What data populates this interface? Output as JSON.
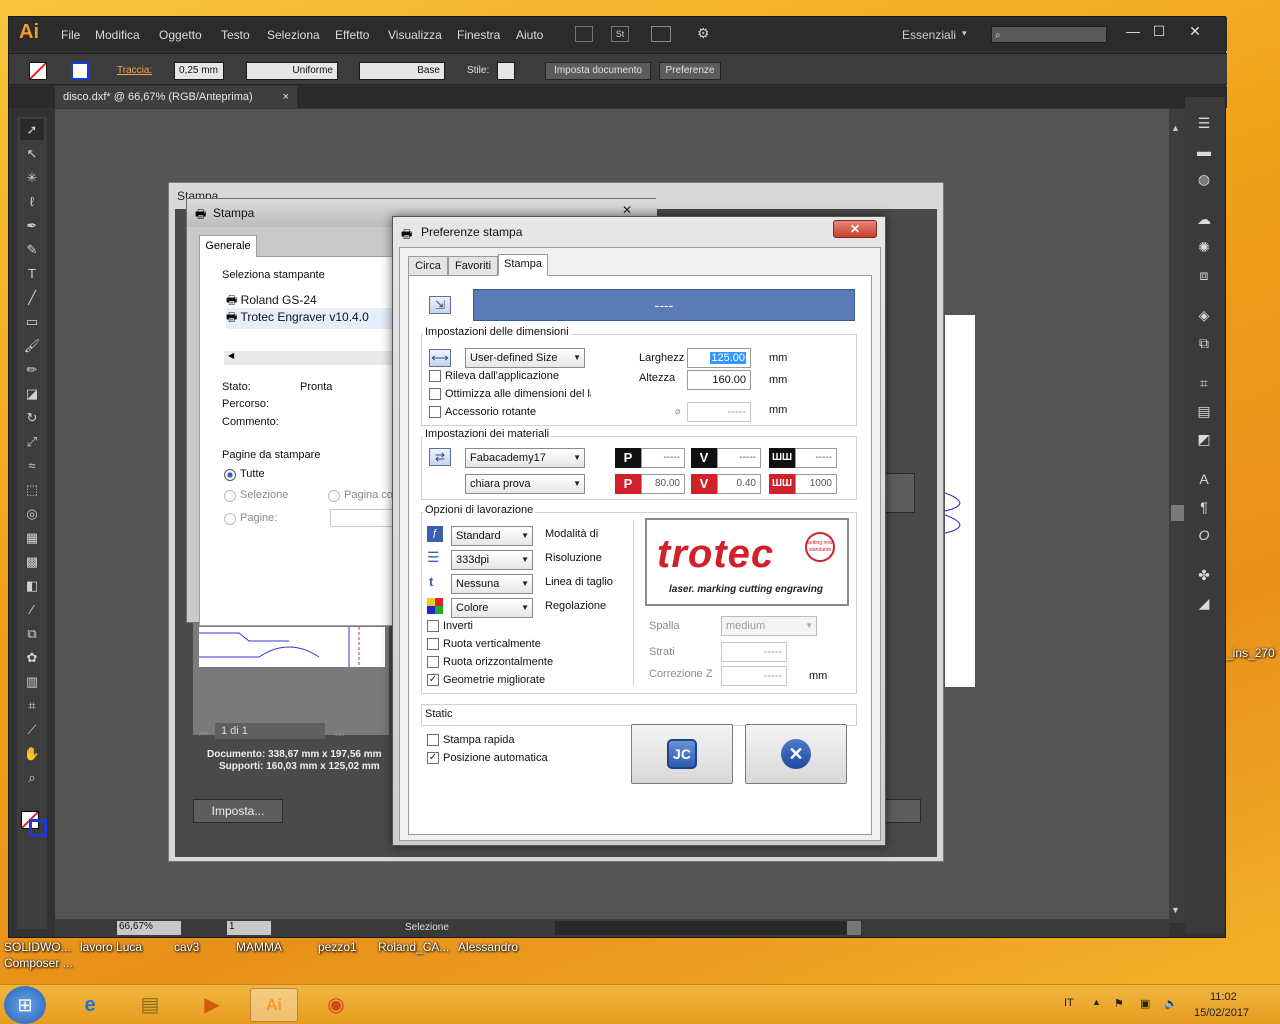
{
  "app": {
    "logo": "Ai",
    "menu": [
      "File",
      "Modifica",
      "Oggetto",
      "Testo",
      "Seleziona",
      "Effetto",
      "Visualizza",
      "Finestra",
      "Aiuto"
    ],
    "workspace": "Essenziali",
    "window_controls": {
      "min": "—",
      "max": "☐",
      "close": "✕"
    }
  },
  "controlbar": {
    "stroke_label": "Traccia:",
    "stroke_value": "0,25 mm",
    "profile": "Uniforme",
    "brush": "Base",
    "style_label": "Stile:",
    "doc_setup": "Imposta documento",
    "prefs": "Preferenze"
  },
  "document_tab": {
    "title": "disco.dxf* @ 66,67% (RGB/Anteprima)",
    "close": "×"
  },
  "statusbar": {
    "zoom": "66,67%",
    "page": "1",
    "tool": "Selezione"
  },
  "ai_print_dialog": {
    "title": "Stampa",
    "pager": "1 di 1",
    "doc_size": "Documento: 338,67 mm x 197,56 mm",
    "media_size": "Supporti: 160,03 mm x 125,02 mm",
    "setup_button": "Imposta..."
  },
  "win_print_dialog": {
    "title": "Stampa",
    "close": "✕",
    "tab": "Generale",
    "select_printer": "Seleziona stampante",
    "printers": [
      "Roland GS-24",
      "Trotec Engraver v10.4.0"
    ],
    "status_label": "Stato:",
    "status_value": "Pronta",
    "path_label": "Percorso:",
    "comment_label": "Commento:",
    "pages_group": "Pagine da stampare",
    "opt_all": "Tutte",
    "opt_selection": "Selezione",
    "opt_current": "Pagina co",
    "opt_pages": "Pagine:"
  },
  "pref": {
    "title": "Preferenze stampa",
    "close": "✕",
    "tabs": [
      "Circa",
      "Favoriti",
      "Stampa"
    ],
    "active_tab": "Stampa",
    "header_value": "----",
    "dims": {
      "group": "Impostazioni delle dimensioni",
      "size": "User-defined Size",
      "width_label": "Larghezza",
      "width_value": "125.00",
      "height_label": "Altezza",
      "height_value": "160.00",
      "diameter_value": "-----",
      "unit": "mm",
      "chk_detect": "Rileva dall'applicazione",
      "chk_optimize": "Ottimizza alle dimensioni del la",
      "chk_rotary": "Accessorio rotante"
    },
    "materials": {
      "group": "Impostazioni dei materiali",
      "material": "Fabacademy17",
      "preset": "chiara prova",
      "p_label": "P",
      "v_label": "V",
      "f_label": "ШШ",
      "p_top": "-----",
      "v_top": "-----",
      "f_top": "-----",
      "p_val": "80.00",
      "v_val": "0.40",
      "f_val": "1000"
    },
    "job": {
      "group": "Opzioni di lavorazione",
      "mode": "Standard",
      "mode_label": "Modalità di",
      "resolution": "333dpi",
      "resolution_label": "Risoluzione",
      "cutline": "Nessuna",
      "cutline_label": "Linea di taglio",
      "adjust": "Colore",
      "adjust_label": "Regolazione",
      "chk_invert": "Inverti",
      "chk_flip_v": "Ruota verticalmente",
      "chk_flip_h": "Ruota orizzontalmente",
      "chk_geom": "Geometrie migliorate",
      "thickness_label": "Spalla",
      "thickness_value": "medium",
      "layers_label": "Strati",
      "layers_value": "-----",
      "zcorr_label": "Correzione Z",
      "zcorr_value": "-----",
      "unit": "mm"
    },
    "logo": {
      "brand": "trotec",
      "tagline": "laser. marking cutting engraving",
      "stamp": "setting new standards"
    },
    "static_label": "Static",
    "chk_quick": "Stampa rapida",
    "chk_autopos": "Posizione automatica"
  },
  "desktop_icons": [
    "SOLIDWO...",
    "Composer ...",
    "lavoro Luca",
    "cav3",
    "MAMMA",
    "pezzo1",
    "Roland_CA...",
    "Alessandro",
    "_ins_270"
  ],
  "taskbar": {
    "lang": "IT",
    "time": "11:02",
    "date": "15/02/2017"
  },
  "colors": {
    "accent_blue": "#5a7ab8",
    "trotec_red": "#d0202a",
    "ai_orange": "#f29a2e"
  }
}
